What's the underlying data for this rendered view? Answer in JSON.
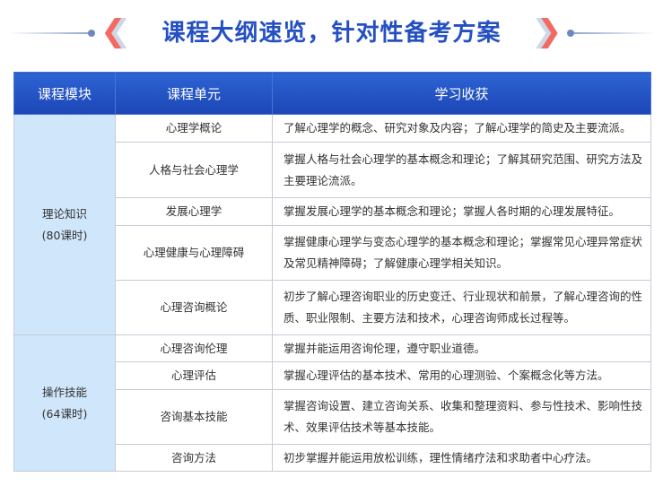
{
  "title": "课程大纲速览，针对性备考方案",
  "table": {
    "headers": [
      "课程模块",
      "课程单元",
      "学习收获"
    ],
    "sections": [
      {
        "module": "理论知识",
        "hours": "(80课时)",
        "rows": [
          {
            "unit": "心理学概论",
            "gain": "了解心理学的概念、研究对象及内容；了解心理学的简史及主要流派。"
          },
          {
            "unit": "人格与社会心理学",
            "gain": "掌握人格与社会心理学的基本概念和理论；了解其研究范围、研究方法及主要理论流派。"
          },
          {
            "unit": "发展心理学",
            "gain": "掌握发展心理学的基本概念和理论；掌握人各时期的心理发展特征。"
          },
          {
            "unit": "心理健康与心理障碍",
            "gain": "掌握健康心理学与变态心理学的基本概念和理论；掌握常见心理异常症状及常见精神障碍；了解健康心理学相关知识。"
          },
          {
            "unit": "心理咨询概论",
            "gain": "初步了解心理咨询职业的历史变迁、行业现状和前景，了解心理咨询的性质、职业限制、主要方法和技术，心理咨询师成长过程等。"
          }
        ]
      },
      {
        "module": "操作技能",
        "hours": "(64课时)",
        "rows": [
          {
            "unit": "心理咨询伦理",
            "gain": "掌握并能运用咨询伦理，遵守职业道德。"
          },
          {
            "unit": "心理评估",
            "gain": "掌握心理评估的基本技术、常用的心理测验、个案概念化等方法。"
          },
          {
            "unit": "咨询基本技能",
            "gain": "掌握咨询设置、建立咨询关系、收集和整理资料、参与性技术、影响性技术、效果评估技术等基本技能。"
          },
          {
            "unit": "咨询方法",
            "gain": "初步掌握并能运用放松训练，理性情绪疗法和求助者中心疗法。"
          }
        ]
      }
    ]
  }
}
